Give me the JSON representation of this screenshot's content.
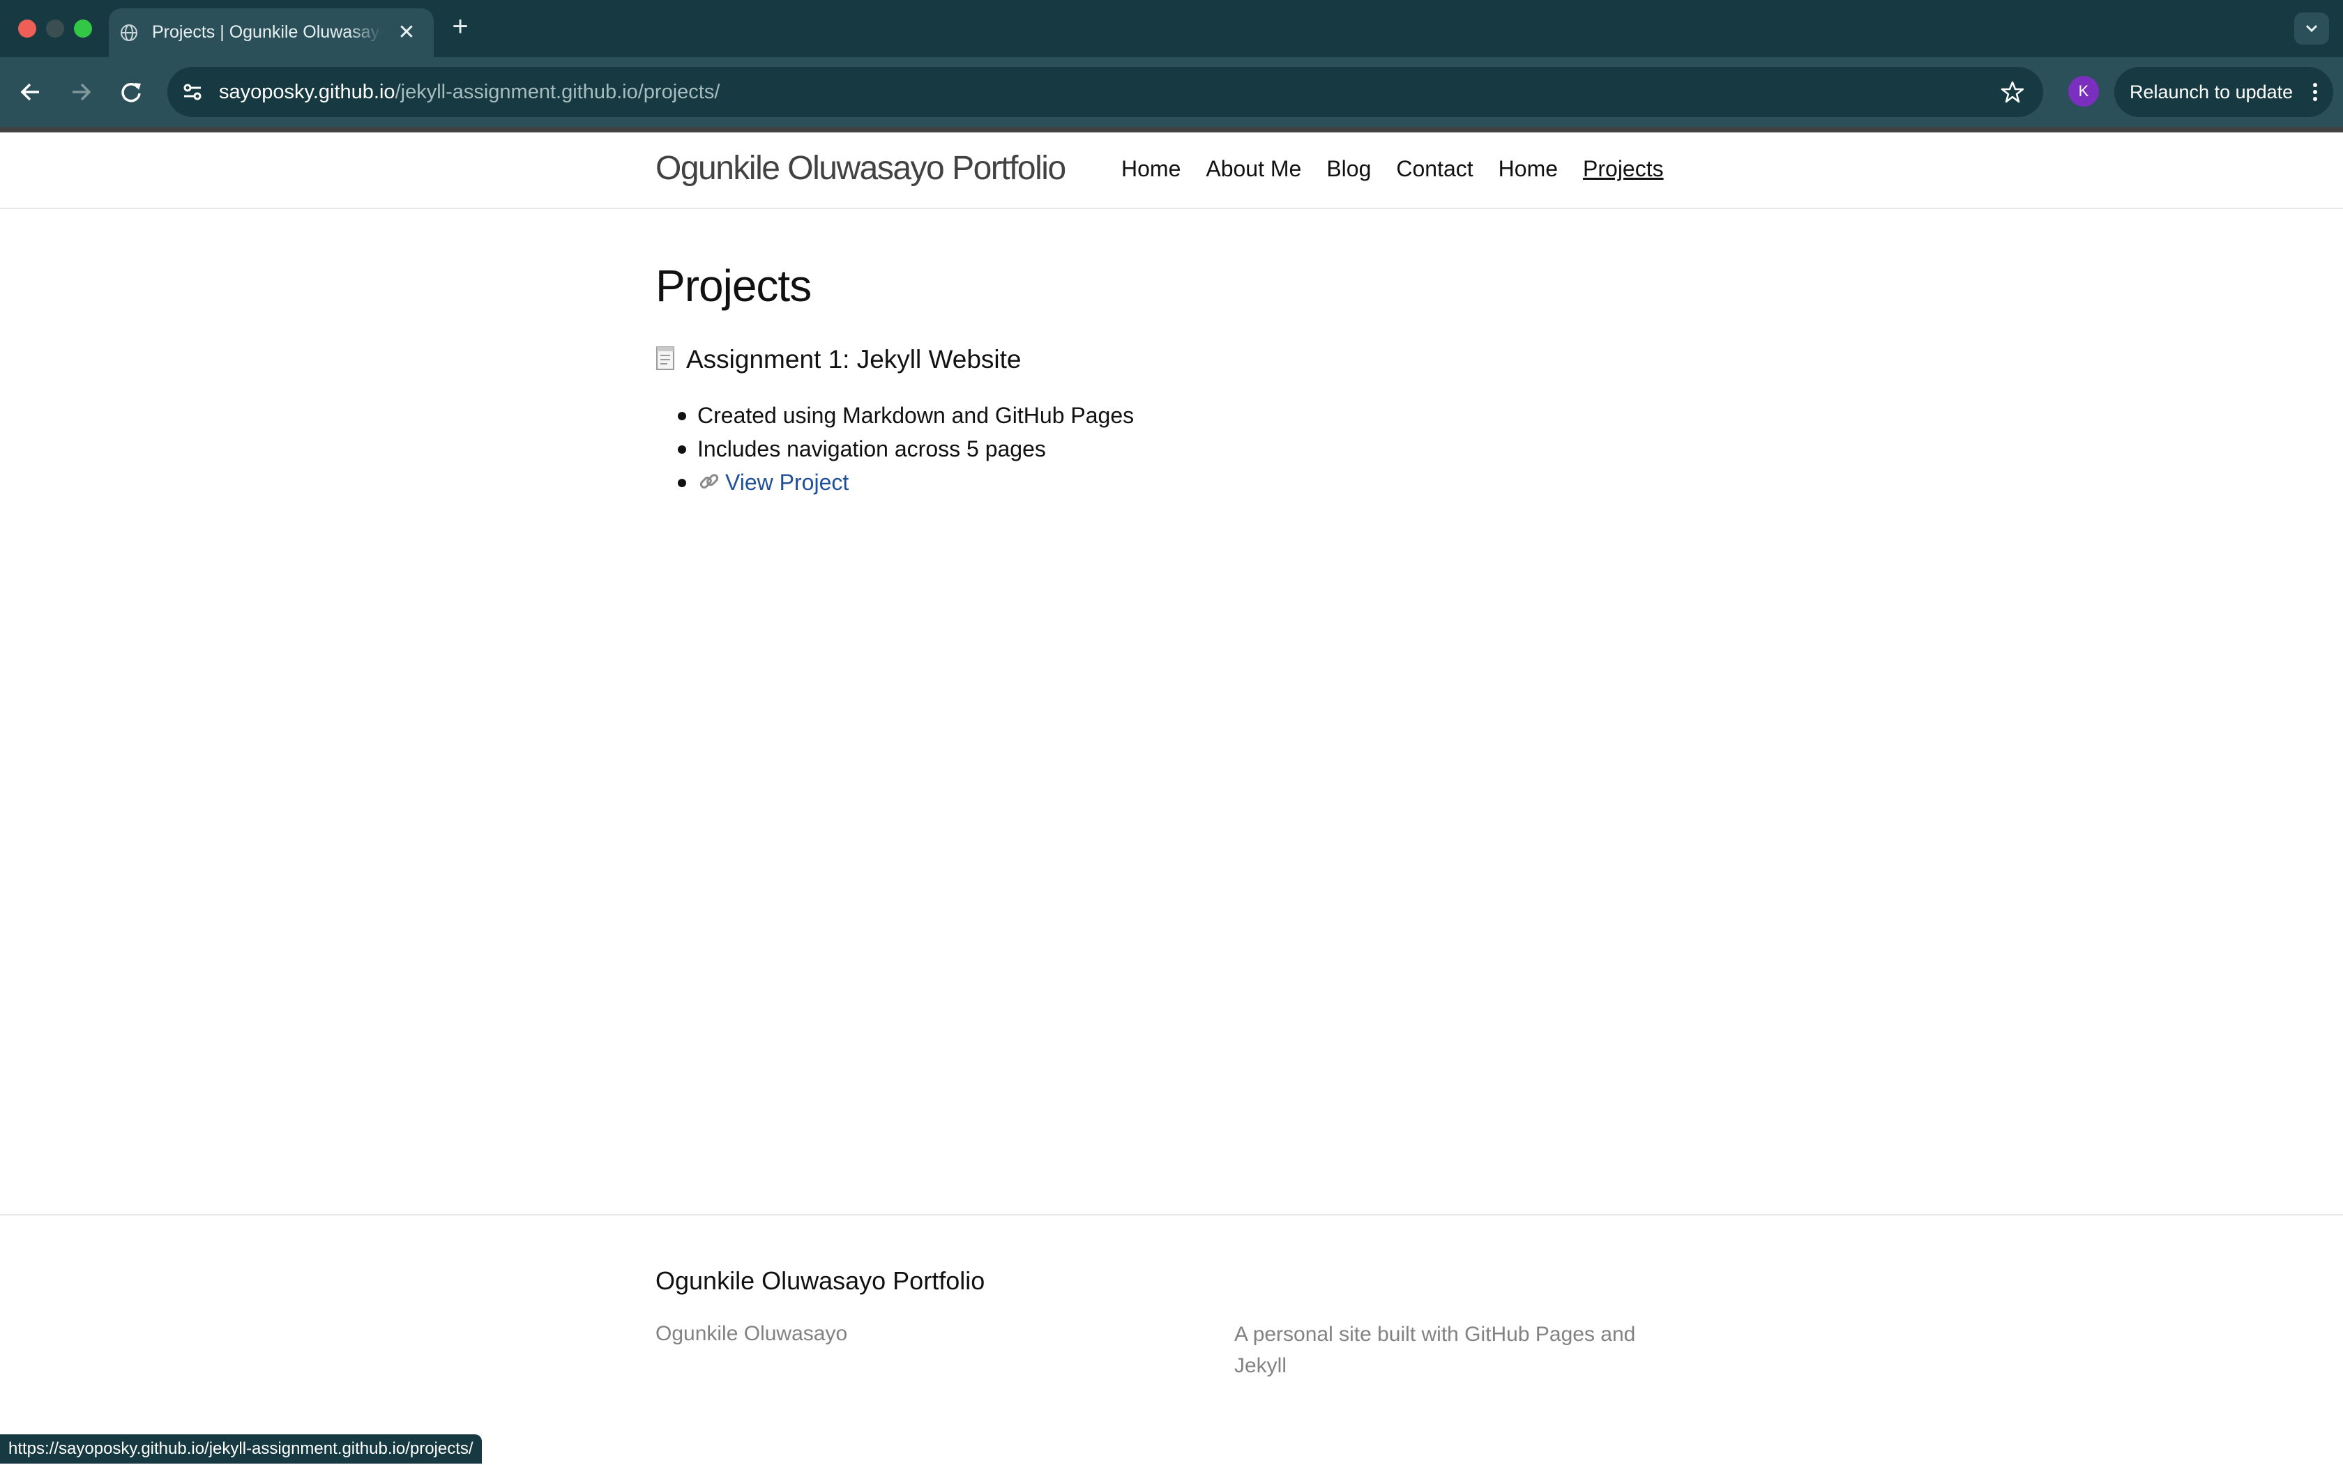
{
  "browser": {
    "tab_title": "Projects | Ogunkile Oluwasayo Portfolio",
    "url_host": "sayoposky.github.io",
    "url_path": "/jekyll-assignment.github.io/projects/",
    "profile_initial": "K",
    "relaunch_label": "Relaunch to update",
    "status_url": "https://sayoposky.github.io/jekyll-assignment.github.io/projects/"
  },
  "site": {
    "title": "Ogunkile Oluwasayo Portfolio",
    "nav": [
      "Home",
      "About Me",
      "Blog",
      "Contact",
      "Home",
      "Projects"
    ],
    "current_nav": "Projects"
  },
  "main": {
    "heading": "Projects",
    "section_title": "Assignment 1: Jekyll Website",
    "bullets": [
      "Created using Markdown and GitHub Pages",
      "Includes navigation across 5 pages"
    ],
    "link_label": "View Project"
  },
  "footer": {
    "heading": "Ogunkile Oluwasayo Portfolio",
    "name": "Ogunkile Oluwasayo",
    "description": "A personal site built with GitHub Pages and Jekyll"
  },
  "colors": {
    "tabbar": "#173941",
    "toolbar": "#2b5059",
    "link": "#1f4f9a",
    "footer_text": "#828282"
  }
}
